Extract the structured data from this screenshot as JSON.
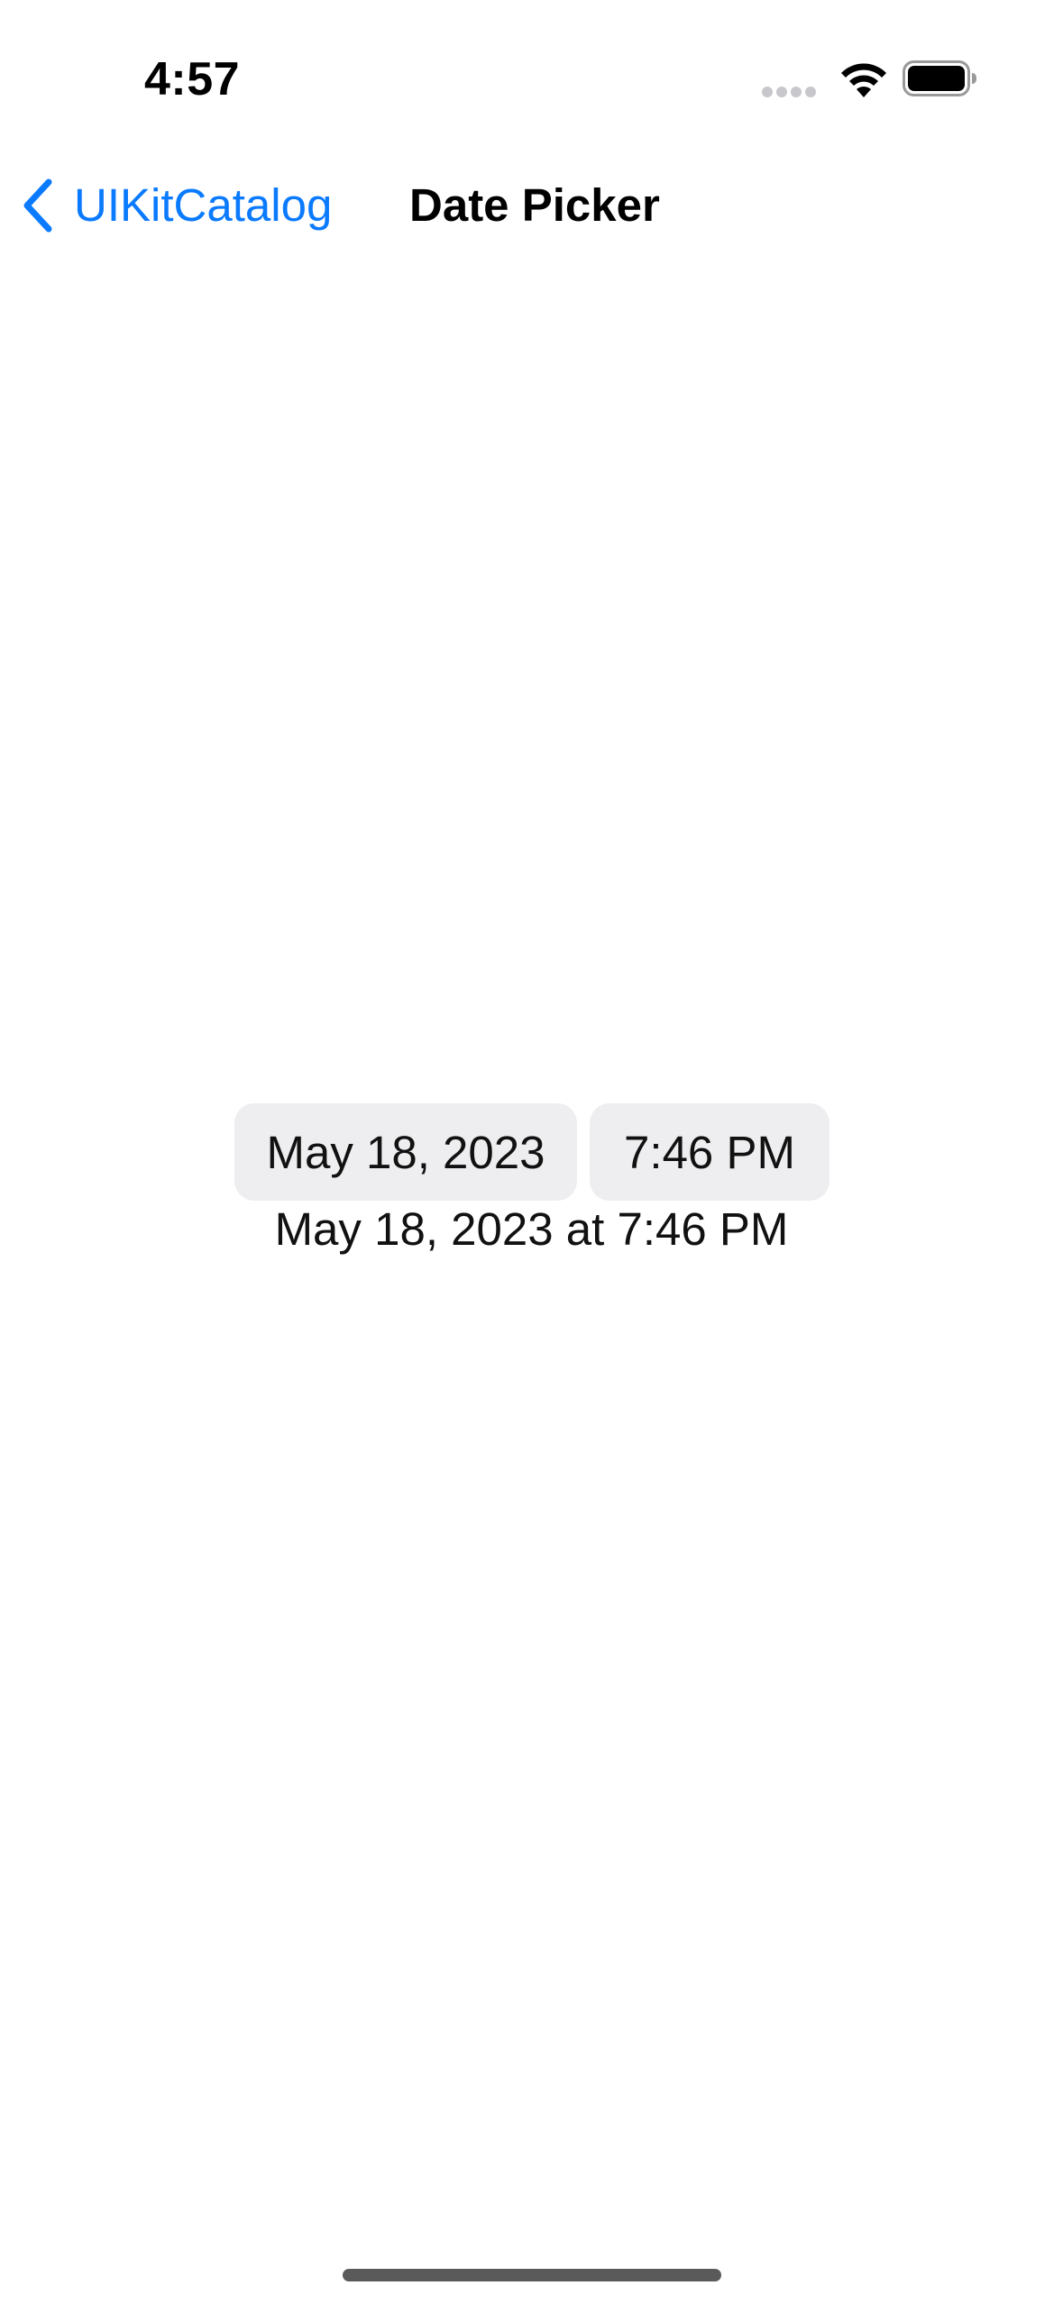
{
  "status_bar": {
    "time": "4:57",
    "signal_icon": "cellular-signal-dots",
    "wifi_icon": "wifi",
    "battery_icon": "battery-full"
  },
  "nav": {
    "back_label": "UIKitCatalog",
    "back_icon": "chevron-left",
    "title": "Date Picker",
    "accent_color": "#0a7aff"
  },
  "picker": {
    "date_value": "May 18, 2023",
    "time_value": "7:46 PM",
    "pill_background": "#eeeef0"
  },
  "result": {
    "text": "May 18, 2023 at 7:46 PM"
  }
}
